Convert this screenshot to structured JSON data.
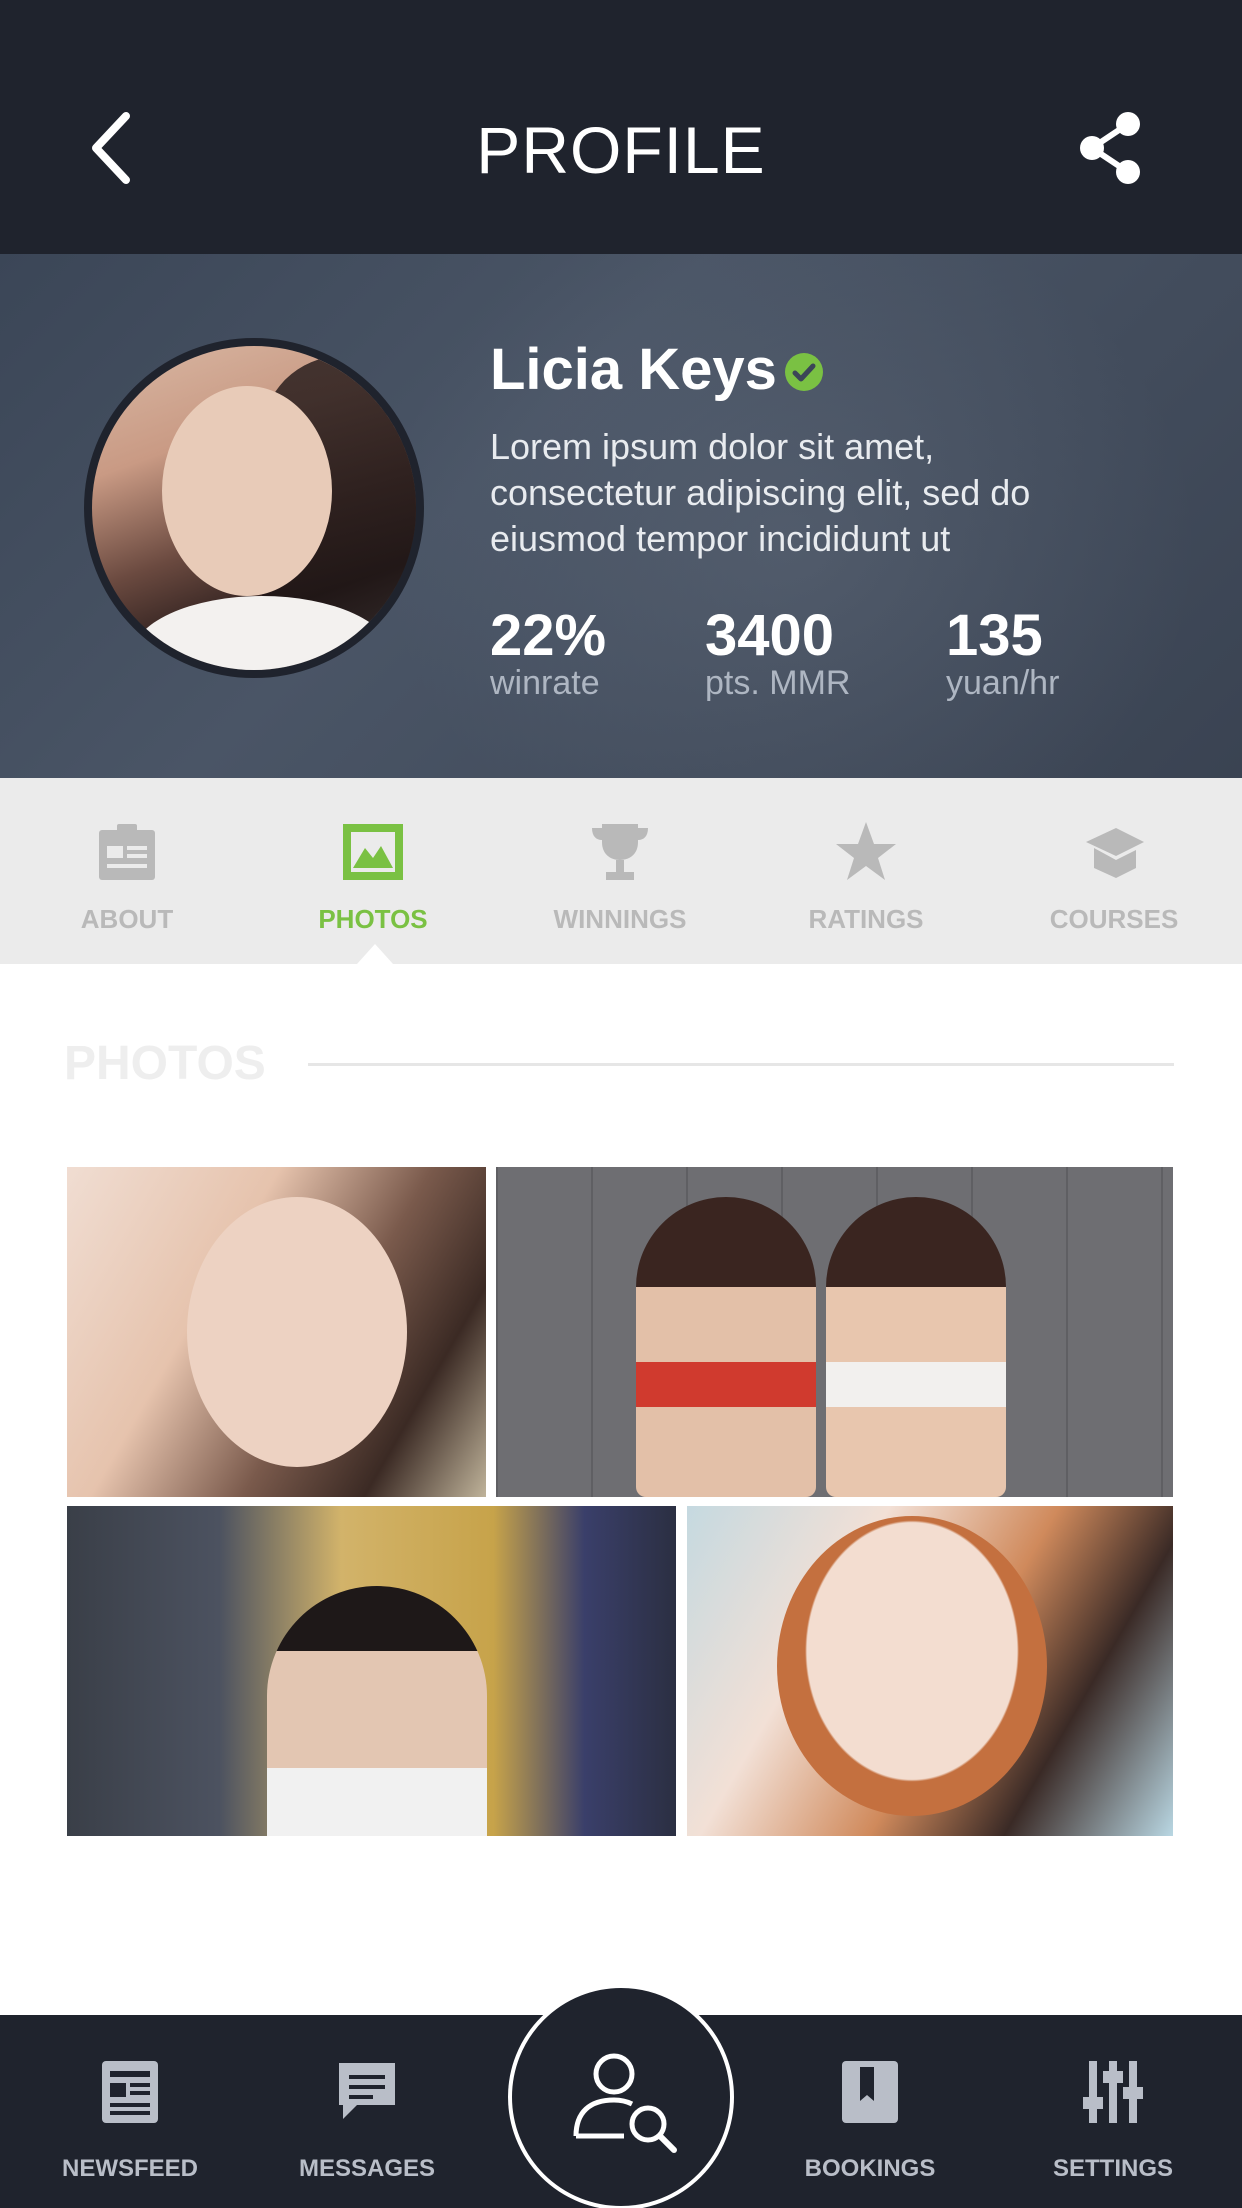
{
  "header": {
    "title": "PROFILE",
    "back_icon": "chevron-left-icon",
    "share_icon": "share-icon"
  },
  "profile": {
    "name": "Licia Keys",
    "verified": true,
    "bio": "Lorem ipsum dolor sit amet, consectetur adipiscing elit, sed do eiusmod tempor incididunt ut",
    "stats": [
      {
        "value": "22%",
        "label": "winrate"
      },
      {
        "value": "3400",
        "label": "pts. MMR"
      },
      {
        "value": "135",
        "label": "yuan/hr"
      }
    ]
  },
  "tabs": {
    "items": [
      {
        "label": "ABOUT",
        "icon": "clipboard-icon",
        "active": false
      },
      {
        "label": "PHOTOS",
        "icon": "image-icon",
        "active": true
      },
      {
        "label": "WINNINGS",
        "icon": "trophy-icon",
        "active": false
      },
      {
        "label": "RATINGS",
        "icon": "star-icon",
        "active": false
      },
      {
        "label": "COURSES",
        "icon": "graduation-cap-icon",
        "active": false
      }
    ]
  },
  "section": {
    "title": "PHOTOS"
  },
  "bottom_nav": {
    "items": [
      {
        "label": "NEWSFEED",
        "icon": "newspaper-icon"
      },
      {
        "label": "MESSAGES",
        "icon": "chat-bubble-icon"
      },
      {
        "label": "BOOKINGS",
        "icon": "bookmark-icon"
      },
      {
        "label": "SETTINGS",
        "icon": "sliders-icon"
      }
    ],
    "center_icon": "user-search-icon"
  },
  "colors": {
    "accent": "#7ac143",
    "dark": "#1f232d",
    "tab_inactive": "#b9b9b9",
    "verified": "#7ac143"
  }
}
